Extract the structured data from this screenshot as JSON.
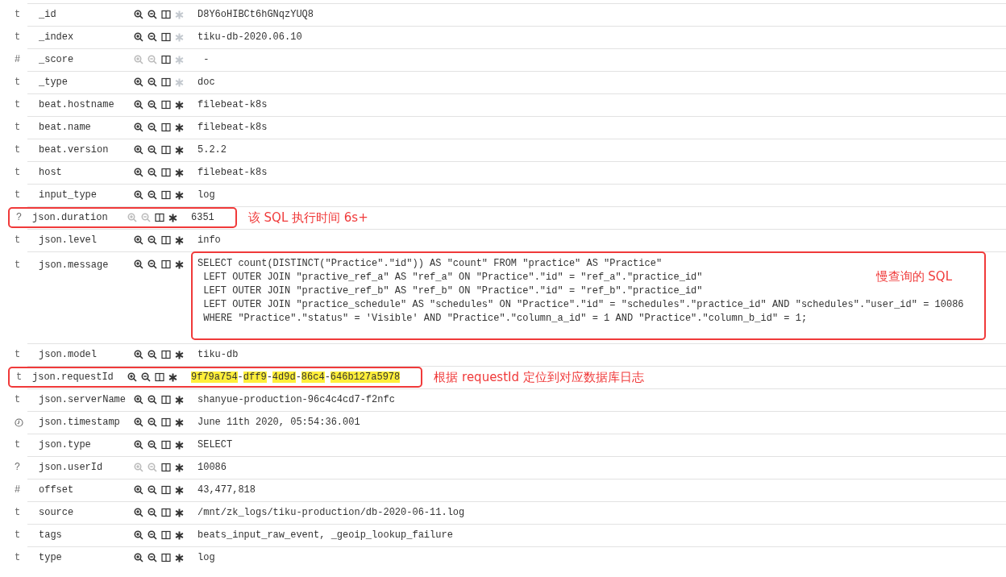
{
  "rows": [
    {
      "kind": "letter",
      "type": "t",
      "name": "_id",
      "filter_enabled": true,
      "exists_enabled": false,
      "value": [
        {
          "text": "D8Y6oHIBCt6hGNqzYUQ8",
          "highlighted": false
        }
      ]
    },
    {
      "kind": "letter",
      "type": "t",
      "name": "_index",
      "filter_enabled": true,
      "exists_enabled": false,
      "value": [
        {
          "text": "tiku-db-2020.06.10",
          "highlighted": false
        }
      ]
    },
    {
      "kind": "letter",
      "type": "#",
      "name": "_score",
      "filter_enabled": false,
      "exists_enabled": false,
      "value": [
        {
          "text": " -",
          "highlighted": false
        }
      ]
    },
    {
      "kind": "letter",
      "type": "t",
      "name": "_type",
      "filter_enabled": true,
      "exists_enabled": false,
      "value": [
        {
          "text": "doc",
          "highlighted": false
        }
      ]
    },
    {
      "kind": "letter",
      "type": "t",
      "name": "beat.hostname",
      "filter_enabled": true,
      "exists_enabled": true,
      "value": [
        {
          "text": "filebeat-k8s",
          "highlighted": false
        }
      ]
    },
    {
      "kind": "letter",
      "type": "t",
      "name": "beat.name",
      "filter_enabled": true,
      "exists_enabled": true,
      "value": [
        {
          "text": "filebeat-k8s",
          "highlighted": false
        }
      ]
    },
    {
      "kind": "letter",
      "type": "t",
      "name": "beat.version",
      "filter_enabled": true,
      "exists_enabled": true,
      "value": [
        {
          "text": "5.2.2",
          "highlighted": false
        }
      ]
    },
    {
      "kind": "letter",
      "type": "t",
      "name": "host",
      "filter_enabled": true,
      "exists_enabled": true,
      "value": [
        {
          "text": "filebeat-k8s",
          "highlighted": false
        }
      ]
    },
    {
      "kind": "letter",
      "type": "t",
      "name": "input_type",
      "filter_enabled": true,
      "exists_enabled": true,
      "value": [
        {
          "text": "log",
          "highlighted": false
        }
      ]
    },
    {
      "kind": "letter",
      "type": "?",
      "name": "json.duration",
      "filter_enabled": false,
      "exists_enabled": true,
      "value": [
        {
          "text": "6351",
          "highlighted": false
        }
      ],
      "annotation": {
        "kind": "row",
        "note": "该 SQL 执行时间 6s+"
      }
    },
    {
      "kind": "letter",
      "type": "t",
      "name": "json.level",
      "filter_enabled": true,
      "exists_enabled": true,
      "value": [
        {
          "text": "info",
          "highlighted": false
        }
      ]
    },
    {
      "kind": "letter",
      "type": "t",
      "name": "json.message",
      "filter_enabled": true,
      "exists_enabled": true,
      "lines": [
        "SELECT count(DISTINCT(\"Practice\".\"id\")) AS \"count\" FROM \"practice\" AS \"Practice\"",
        " LEFT OUTER JOIN \"practive_ref_a\" AS \"ref_a\" ON \"Practice\".\"id\" = \"ref_a\".\"practice_id\"",
        " LEFT OUTER JOIN \"practive_ref_b\" AS \"ref_b\" ON \"Practice\".\"id\" = \"ref_b\".\"practice_id\"",
        " LEFT OUTER JOIN \"practice_schedule\" AS \"schedules\" ON \"Practice\".\"id\" = \"schedules\".\"practice_id\" AND \"schedules\".\"user_id\" = 10086",
        " WHERE \"Practice\".\"status\" = 'Visible' AND \"Practice\".\"column_a_id\" = 1 AND \"Practice\".\"column_b_id\" = 1;"
      ],
      "annotation": {
        "kind": "value",
        "note": "慢查询的 SQL"
      }
    },
    {
      "kind": "letter",
      "type": "t",
      "name": "json.model",
      "filter_enabled": true,
      "exists_enabled": true,
      "value": [
        {
          "text": "tiku-db",
          "highlighted": false
        }
      ]
    },
    {
      "kind": "letter",
      "type": "t",
      "name": "json.requestId",
      "filter_enabled": true,
      "exists_enabled": true,
      "value": [
        {
          "text": "9f79a754",
          "highlighted": true
        },
        {
          "text": "-",
          "highlighted": false
        },
        {
          "text": "dff9",
          "highlighted": true
        },
        {
          "text": "-",
          "highlighted": false
        },
        {
          "text": "4d9d",
          "highlighted": true
        },
        {
          "text": "-",
          "highlighted": false
        },
        {
          "text": "86c4",
          "highlighted": true
        },
        {
          "text": "-",
          "highlighted": false
        },
        {
          "text": "646b127a5978",
          "highlighted": true
        }
      ],
      "annotation": {
        "kind": "row",
        "note": "根据 requestId 定位到对应数据库日志"
      }
    },
    {
      "kind": "letter",
      "type": "t",
      "name": "json.serverName",
      "filter_enabled": true,
      "exists_enabled": true,
      "value": [
        {
          "text": "shanyue-production-96c4c4cd7-f2nfc",
          "highlighted": false
        }
      ]
    },
    {
      "kind": "date",
      "name": "json.timestamp",
      "filter_enabled": true,
      "exists_enabled": true,
      "value": [
        {
          "text": "June 11th 2020, 05:54:36.001",
          "highlighted": false
        }
      ]
    },
    {
      "kind": "letter",
      "type": "t",
      "name": "json.type",
      "filter_enabled": true,
      "exists_enabled": true,
      "value": [
        {
          "text": "SELECT",
          "highlighted": false
        }
      ]
    },
    {
      "kind": "letter",
      "type": "?",
      "name": "json.userId",
      "filter_enabled": false,
      "exists_enabled": true,
      "value": [
        {
          "text": "10086",
          "highlighted": false
        }
      ]
    },
    {
      "kind": "letter",
      "type": "#",
      "name": "offset",
      "filter_enabled": true,
      "exists_enabled": true,
      "value": [
        {
          "text": "43,477,818",
          "highlighted": false
        }
      ]
    },
    {
      "kind": "letter",
      "type": "t",
      "name": "source",
      "filter_enabled": true,
      "exists_enabled": true,
      "value": [
        {
          "text": "/mnt/zk_logs/tiku-production/db-2020-06-11.log",
          "highlighted": false
        }
      ]
    },
    {
      "kind": "letter",
      "type": "t",
      "name": "tags",
      "filter_enabled": true,
      "exists_enabled": true,
      "value": [
        {
          "text": "beats_input_raw_event, _geoip_lookup_failure",
          "highlighted": false
        }
      ]
    },
    {
      "kind": "letter",
      "type": "t",
      "name": "type",
      "filter_enabled": true,
      "exists_enabled": true,
      "value": [
        {
          "text": "log",
          "highlighted": false
        }
      ]
    }
  ]
}
